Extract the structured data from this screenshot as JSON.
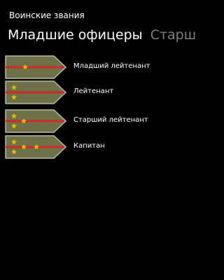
{
  "app": {
    "title": "Воинские звания"
  },
  "pivot": {
    "tabs": [
      {
        "label": "Младшие офицеры",
        "active": true
      },
      {
        "label": "Старш",
        "active": false
      }
    ]
  },
  "colors": {
    "background": "#000000",
    "strap_fill": "#6e7047",
    "strap_border": "#b9b9a0",
    "stripe": "#d22a2a",
    "star": "#e8c000",
    "inactive_text": "#7f7f7f"
  },
  "ranks": [
    {
      "label": "Младший лейтенант",
      "stars": 1,
      "icon": "shoulder-strap-1-star-icon"
    },
    {
      "label": "Лейтенант",
      "stars": 2,
      "icon": "shoulder-strap-2-stars-icon"
    },
    {
      "label": "Старший лейтенант",
      "stars": 3,
      "icon": "shoulder-strap-3-stars-icon"
    },
    {
      "label": "Капитан",
      "stars": 4,
      "icon": "shoulder-strap-4-stars-icon"
    }
  ]
}
